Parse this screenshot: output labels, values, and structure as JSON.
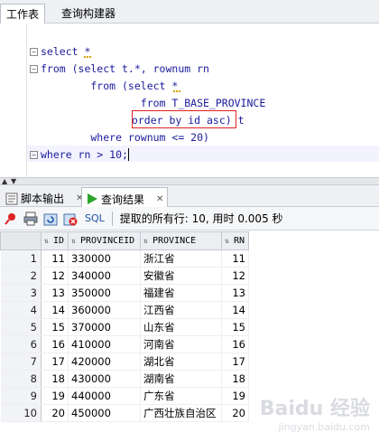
{
  "top_tabs": [
    {
      "label": "工作表"
    },
    {
      "label": "查询构建器"
    }
  ],
  "editor": {
    "lines": [
      "select *",
      "from (select t.*, rownum rn",
      "        from (select *",
      "                from T_BASE_PROVINCE",
      "              order by id asc) t",
      "        where rownum <= 20)",
      "where rn > 10;"
    ]
  },
  "bottom_tabs": [
    {
      "label": "脚本输出"
    },
    {
      "label": "查询结果"
    }
  ],
  "toolbar": {
    "sql_label": "SQL",
    "status_text": "提取的所有行: 10, 用时 0.005 秒"
  },
  "grid": {
    "columns": [
      "ID",
      "PROVINCEID",
      "PROVINCE",
      "RN"
    ],
    "rows": [
      {
        "rownum": "1",
        "id": "11",
        "provinceid": "330000",
        "province": "浙江省",
        "rn": "11"
      },
      {
        "rownum": "2",
        "id": "12",
        "provinceid": "340000",
        "province": "安徽省",
        "rn": "12"
      },
      {
        "rownum": "3",
        "id": "13",
        "provinceid": "350000",
        "province": "福建省",
        "rn": "13"
      },
      {
        "rownum": "4",
        "id": "14",
        "provinceid": "360000",
        "province": "江西省",
        "rn": "14"
      },
      {
        "rownum": "5",
        "id": "15",
        "provinceid": "370000",
        "province": "山东省",
        "rn": "15"
      },
      {
        "rownum": "6",
        "id": "16",
        "provinceid": "410000",
        "province": "河南省",
        "rn": "16"
      },
      {
        "rownum": "7",
        "id": "17",
        "provinceid": "420000",
        "province": "湖北省",
        "rn": "17"
      },
      {
        "rownum": "8",
        "id": "18",
        "provinceid": "430000",
        "province": "湖南省",
        "rn": "18"
      },
      {
        "rownum": "9",
        "id": "19",
        "provinceid": "440000",
        "province": "广东省",
        "rn": "19"
      },
      {
        "rownum": "10",
        "id": "20",
        "provinceid": "450000",
        "province": "广西壮族自治区",
        "rn": "20"
      }
    ]
  },
  "watermark": {
    "text": "Baidu 经验",
    "sub": "jingyan.baidu.com"
  },
  "colors": {
    "keyword": "#1a1a9c",
    "highlight_box": "#e02020",
    "grid_header": "#eceef2"
  }
}
